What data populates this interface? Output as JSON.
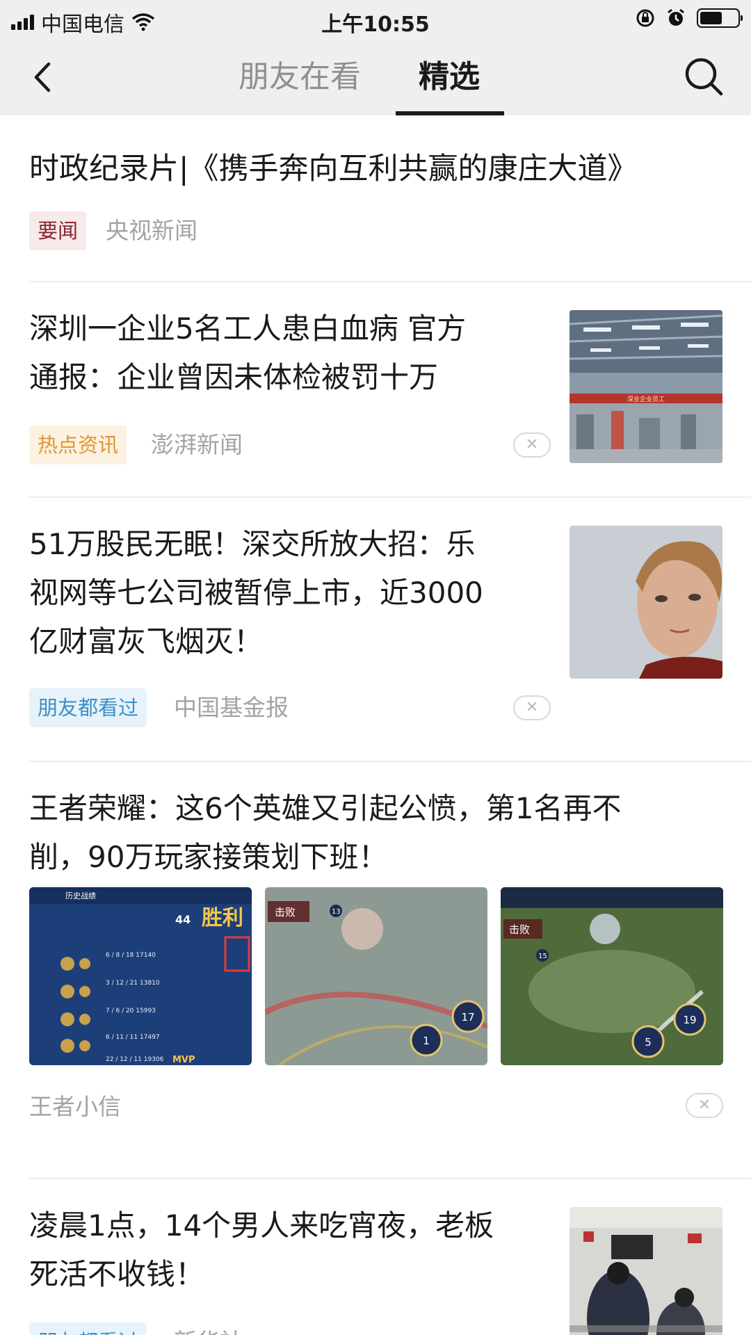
{
  "status_bar": {
    "carrier": "中国电信",
    "time": "上午10:55",
    "battery_level": 0.6
  },
  "nav": {
    "tabs": [
      {
        "label": "朋友在看",
        "active": false
      },
      {
        "label": "精选",
        "active": true
      }
    ]
  },
  "feed": [
    {
      "title": "时政纪录片|《携手奔向互利共赢的康庄大道》",
      "tag": "要闻",
      "source": "央视新闻"
    },
    {
      "title_lines": [
        "深圳一企业5名工人患白血病 官方",
        "通报：企业曾因未体检被罚十万"
      ],
      "tag": "热点资讯",
      "source": "澎湃新闻",
      "thumb_text": "深业企业员工"
    },
    {
      "title_lines": [
        "51万股民无眠！深交所放大招：乐",
        "视网等七公司被暂停上市，近3000",
        "亿财富灰飞烟灭！"
      ],
      "tag": "朋友都看过",
      "source": "中国基金报"
    },
    {
      "title_lines": [
        "王者荣耀：这6个英雄又引起公愤，第1名再不",
        "削，90万玩家接策划下班！"
      ],
      "source": "王者小信",
      "images": [
        {
          "caption": "历史战绩",
          "score": "44",
          "badge": "胜利",
          "mvp": "MVP",
          "rows": [
            "6 / 8 / 18  17140",
            "3 / 12 / 21  13810",
            "7 / 6 / 20  15993",
            "6 / 11 / 11  17497",
            "22 / 12 / 11  19306"
          ]
        },
        {
          "caption": "击败",
          "level": "13",
          "num_a": "17",
          "num_b": "1"
        },
        {
          "caption": "击败",
          "level": "15",
          "num_a": "19",
          "num_b": "5"
        }
      ]
    },
    {
      "title_lines": [
        "凌晨1点，14个男人来吃宵夜，老板",
        "死活不收钱！"
      ],
      "tag": "朋友都看过",
      "source": "新华社"
    }
  ]
}
